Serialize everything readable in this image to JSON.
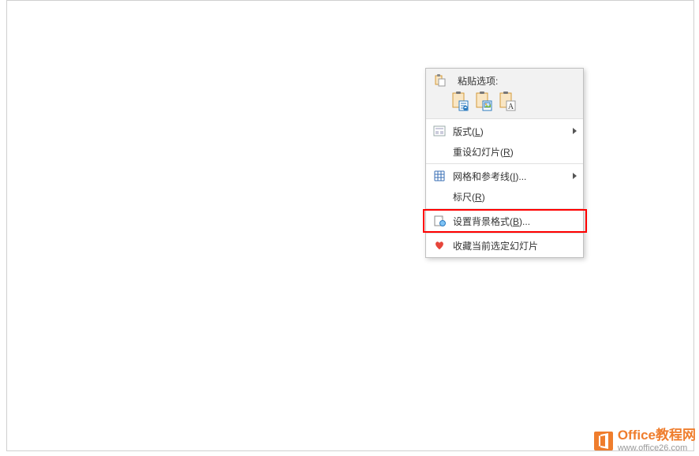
{
  "contextMenu": {
    "headerLabel": "粘贴选项:",
    "items": {
      "layout": {
        "label": "版式",
        "key": "L"
      },
      "resetSlide": {
        "label": "重设幻灯片",
        "key": "R"
      },
      "gridGuides": {
        "label": "网格和参考线",
        "key": "I",
        "suffix": "..."
      },
      "ruler": {
        "label": "标尺",
        "key": "R"
      },
      "formatBackground": {
        "label": "设置背景格式",
        "key": "B",
        "suffix": "..."
      },
      "favoriteSlide": {
        "label": "收藏当前选定幻灯片"
      }
    }
  },
  "watermark": {
    "title": "Office教程网",
    "url": "www.office26.com"
  }
}
